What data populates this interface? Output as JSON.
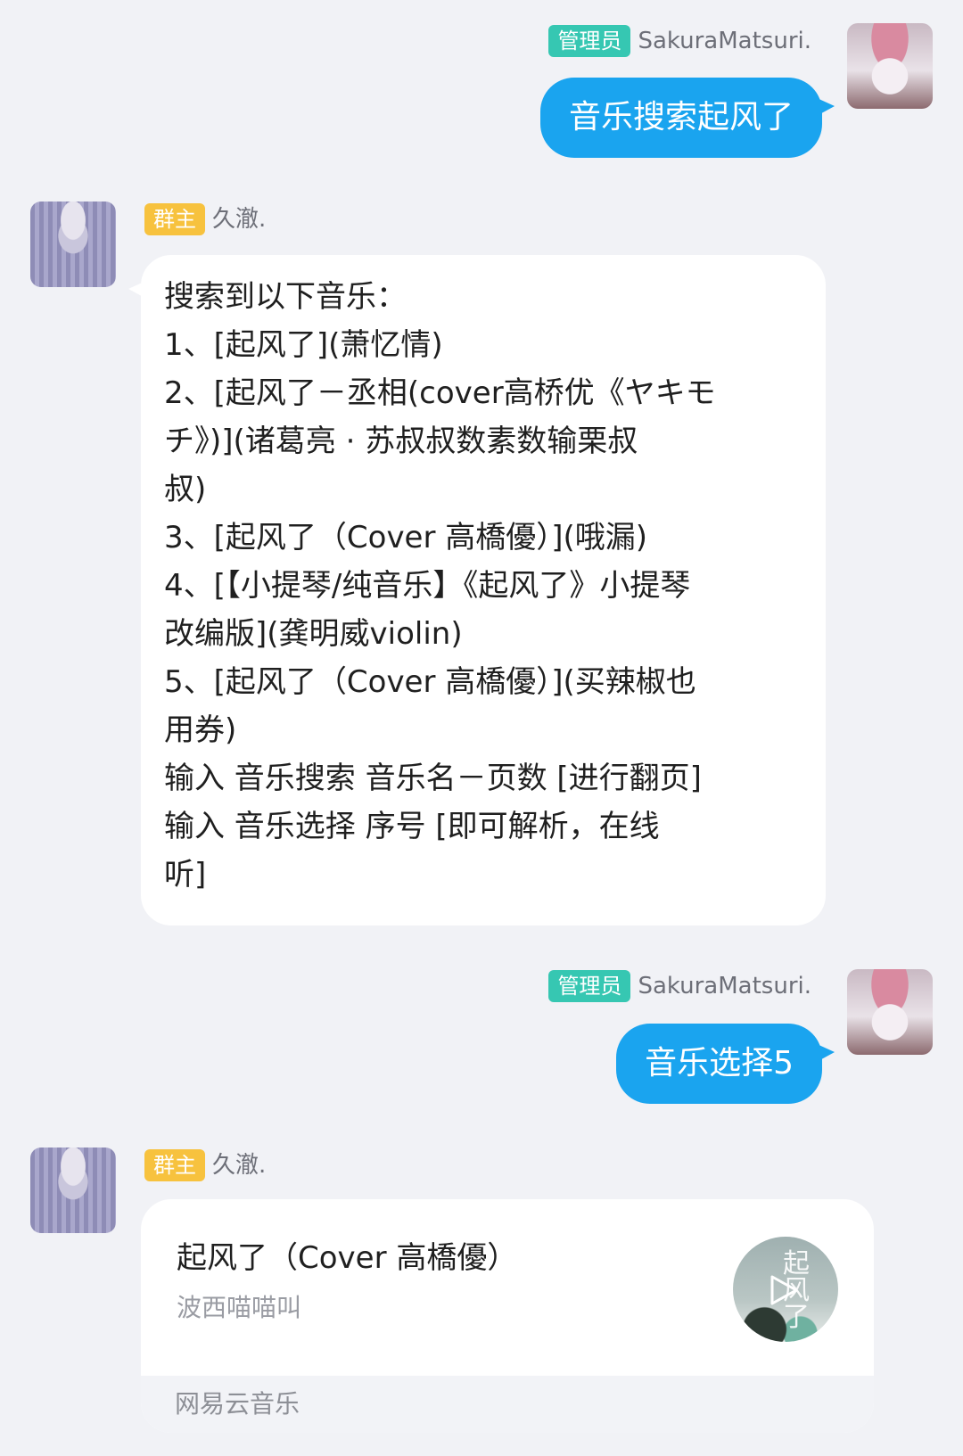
{
  "messages": [
    {
      "sender": {
        "role_badge": "管理员",
        "name": "SakuraMatsuri."
      },
      "text": "音乐搜索起风了"
    },
    {
      "sender": {
        "role_badge": "群主",
        "name": "久澈."
      },
      "lines": [
        "搜索到以下音乐：",
        "1、[起风了](萧忆情)",
        "2、[起风了－丞相(cover高桥优《ヤキモ",
        "チ》)](诸葛亮 · 苏叔叔数素数输栗叔",
        "叔)",
        "3、[起风了（Cover 高橋優）](哦漏)",
        "4、[【小提琴/纯音乐】《起风了》小提琴",
        "改编版](龚明威violin)",
        "5、[起风了（Cover 高橋優）](买辣椒也",
        "用券)",
        "输入 音乐搜索 音乐名－页数 [进行翻页]",
        "输入 音乐选择 序号 [即可解析，在线",
        "听]"
      ]
    },
    {
      "sender": {
        "role_badge": "管理员",
        "name": "SakuraMatsuri."
      },
      "text": "音乐选择5"
    },
    {
      "sender": {
        "role_badge": "群主",
        "name": "久澈."
      },
      "music_card": {
        "title": "起风了（Cover 高橋優）",
        "artist": "波西喵喵叫",
        "source": "网易云音乐",
        "cover_text": "起风了"
      }
    }
  ],
  "colors": {
    "background": "#f1f2f6",
    "outgoing_bubble": "#1aa4ef",
    "admin_badge": "#36c7b2",
    "owner_badge": "#f7c23e"
  },
  "icons": [
    "play-icon"
  ]
}
